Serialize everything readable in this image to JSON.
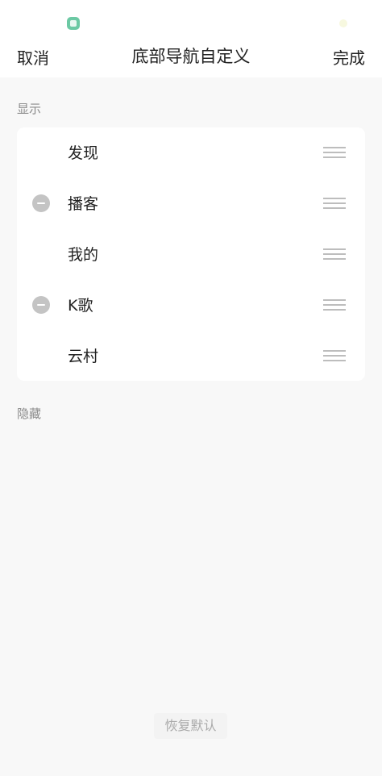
{
  "header": {
    "cancel_label": "取消",
    "title": "底部导航自定义",
    "done_label": "完成"
  },
  "sections": {
    "shown_label": "显示",
    "hidden_label": "隐藏"
  },
  "items": [
    {
      "label": "发现",
      "removable": false
    },
    {
      "label": "播客",
      "removable": true
    },
    {
      "label": "我的",
      "removable": false
    },
    {
      "label": "K歌",
      "removable": true
    },
    {
      "label": "云村",
      "removable": false
    }
  ],
  "footer": {
    "restore_label": "恢复默认"
  },
  "colors": {
    "app_icon": "#6cc9a4",
    "background": "#f8f8f8",
    "remove_button": "#c4c4c4"
  },
  "icons": {
    "remove": "minus-circle-icon",
    "drag": "drag-handle-icon"
  }
}
